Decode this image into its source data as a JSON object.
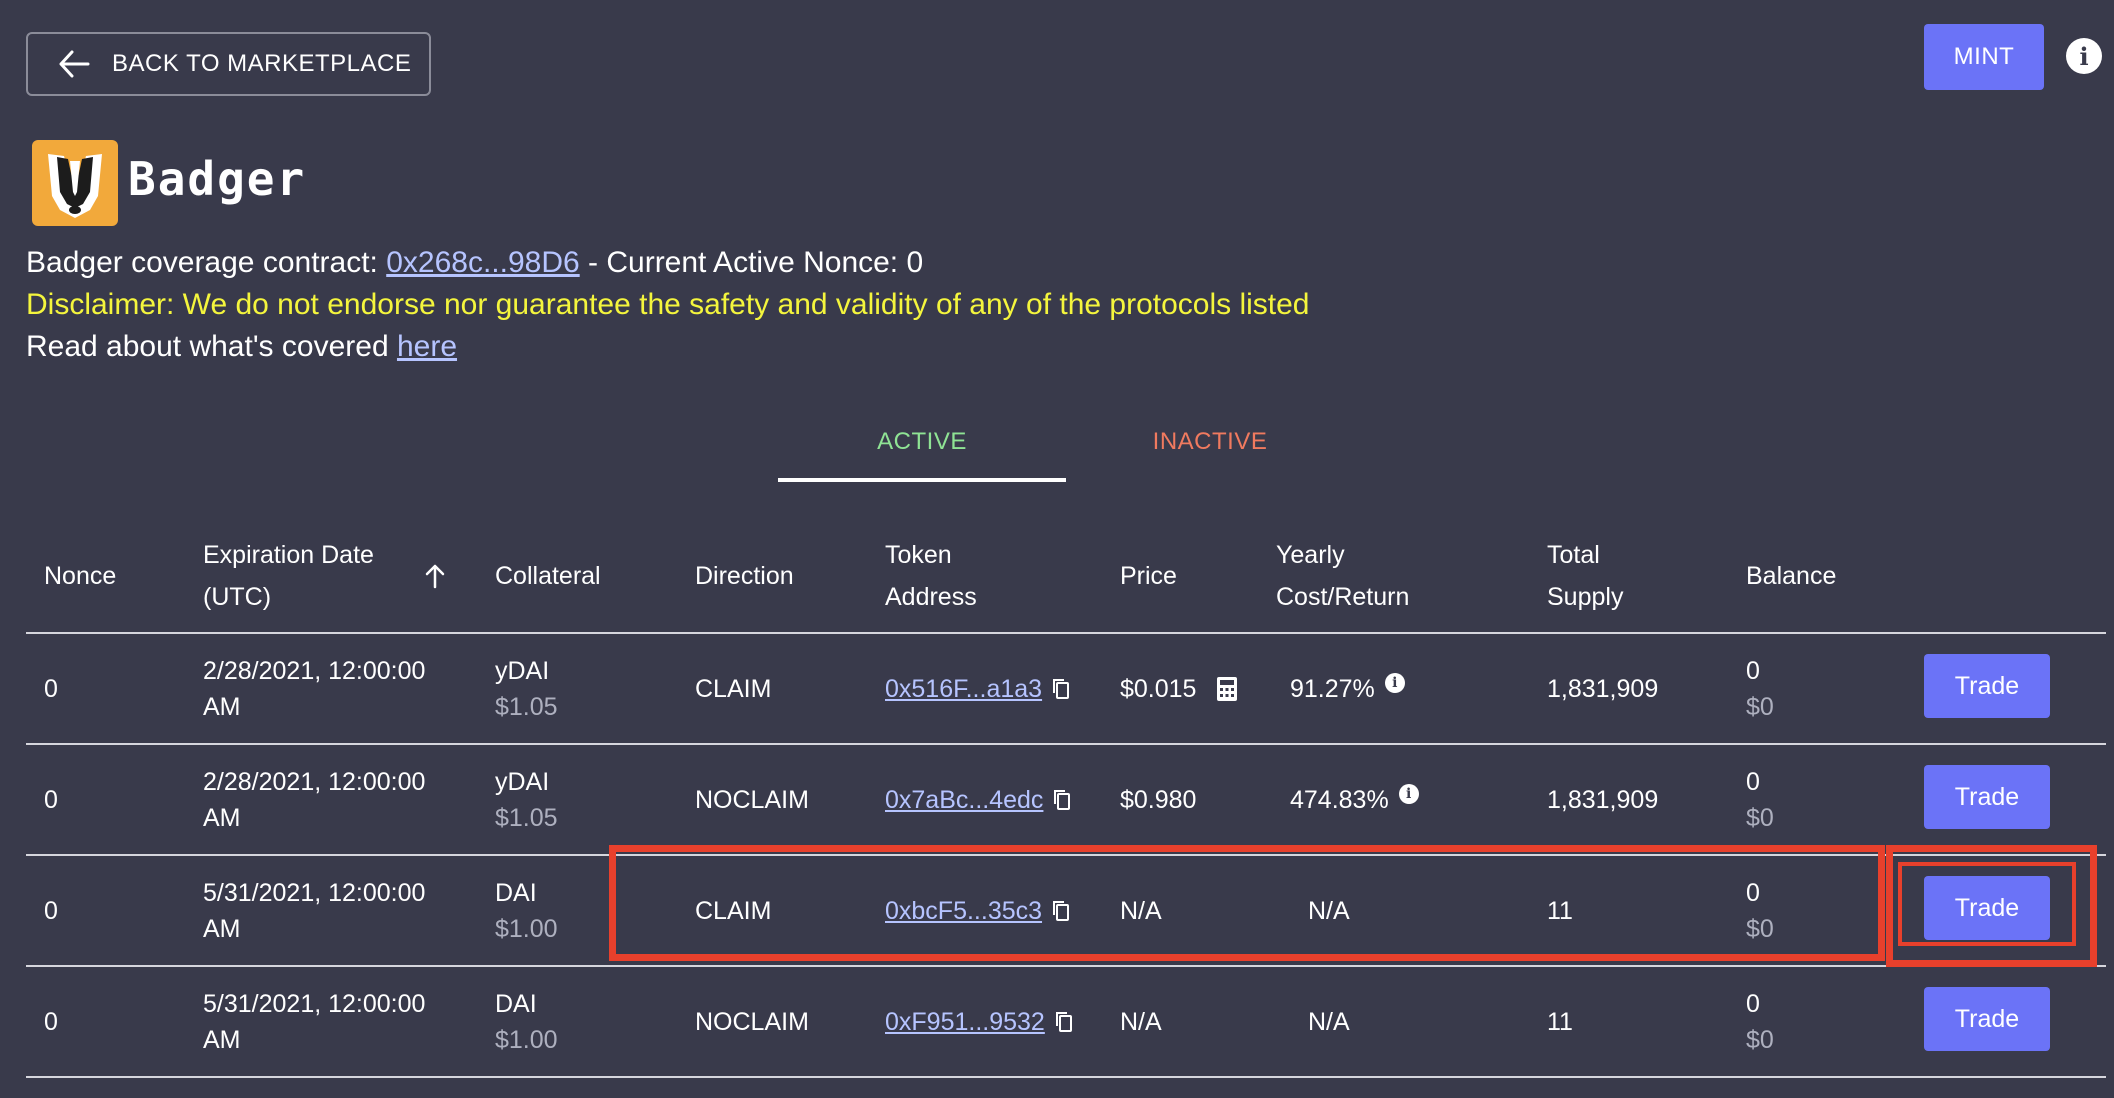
{
  "header": {
    "back_label": "BACK TO MARKETPLACE",
    "mint_label": "MINT"
  },
  "brand": {
    "name": "Badger"
  },
  "info": {
    "contract_prefix": "Badger coverage contract: ",
    "contract_link": "0x268c...98D6",
    "nonce_text": " - Current Active Nonce: 0",
    "disclaimer": "Disclaimer: We do not endorse nor guarantee the safety and validity of any of the protocols listed",
    "read_prefix": "Read about what's covered ",
    "read_link": "here"
  },
  "tabs": [
    {
      "label": "ACTIVE"
    },
    {
      "label": "INACTIVE"
    }
  ],
  "columns": {
    "nonce": "Nonce",
    "expiration_l1": "Expiration Date",
    "expiration_l2": "(UTC)",
    "collateral": "Collateral",
    "direction": "Direction",
    "token_l1": "Token",
    "token_l2": "Address",
    "price": "Price",
    "yearly_l1": "Yearly",
    "yearly_l2": "Cost/Return",
    "supply_l1": "Total",
    "supply_l2": "Supply",
    "balance": "Balance"
  },
  "rows": [
    {
      "nonce": "0",
      "date_l1": "2/28/2021, 12:00:00",
      "date_l2": "AM",
      "collateral": "yDAI",
      "collateral_price": "$1.05",
      "direction": "CLAIM",
      "address": "0x516F...a1a3",
      "price": "$0.015",
      "yearly": "91.27%",
      "supply": "1,831,909",
      "balance": "0",
      "balance_usd": "$0",
      "trade": "Trade"
    },
    {
      "nonce": "0",
      "date_l1": "2/28/2021, 12:00:00",
      "date_l2": "AM",
      "collateral": "yDAI",
      "collateral_price": "$1.05",
      "direction": "NOCLAIM",
      "address": "0x7aBc...4edc",
      "price": "$0.980",
      "yearly": "474.83%",
      "supply": "1,831,909",
      "balance": "0",
      "balance_usd": "$0",
      "trade": "Trade"
    },
    {
      "nonce": "0",
      "date_l1": "5/31/2021, 12:00:00",
      "date_l2": "AM",
      "collateral": "DAI",
      "collateral_price": "$1.00",
      "direction": "CLAIM",
      "address": "0xbcF5...35c3",
      "price": "N/A",
      "yearly": "N/A",
      "supply": "11",
      "balance": "0",
      "balance_usd": "$0",
      "trade": "Trade"
    },
    {
      "nonce": "0",
      "date_l1": "5/31/2021, 12:00:00",
      "date_l2": "AM",
      "collateral": "DAI",
      "collateral_price": "$1.00",
      "direction": "NOCLAIM",
      "address": "0xF951...9532",
      "price": "N/A",
      "yearly": "N/A",
      "supply": "11",
      "balance": "0",
      "balance_usd": "$0",
      "trade": "Trade"
    }
  ],
  "colors": {
    "background": "#393a4b",
    "accent": "#6b73f7",
    "disclaimer": "#f4f53d",
    "tab_active": "#8fe394",
    "tab_inactive": "#f07a5f",
    "link": "#b6c4ff",
    "highlight": "#e8402c"
  }
}
